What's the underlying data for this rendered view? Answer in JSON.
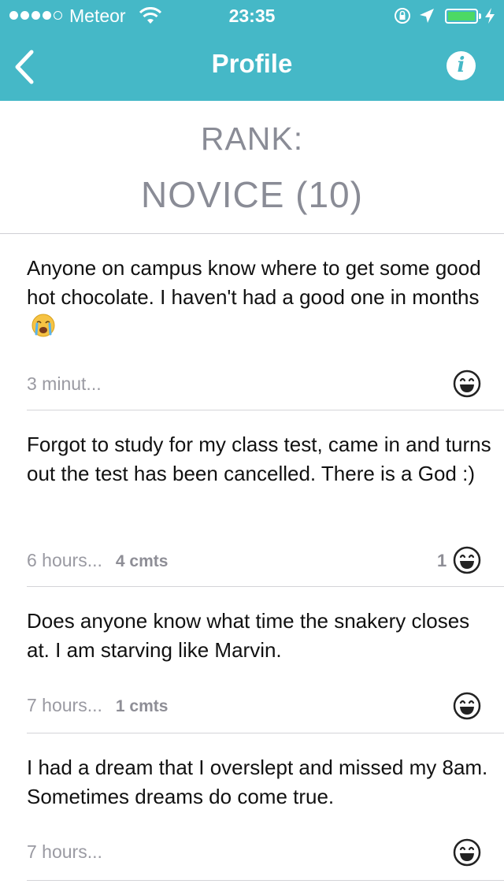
{
  "status_bar": {
    "carrier": "Meteor",
    "time": "23:35",
    "battery_color": "#4cd964"
  },
  "nav": {
    "title": "Profile",
    "accent": "#45b8c7"
  },
  "rank": {
    "label": "RANK:",
    "value": "NOVICE (10)"
  },
  "posts": [
    {
      "text": "Anyone on campus know where to get some good hot chocolate. I haven't had a good one in months",
      "emoji": "crying-face-icon",
      "time": "3 minut...",
      "comments": "",
      "votes": ""
    },
    {
      "text": "Forgot to study for my class test, came in and turns out the test has been cancelled. There is a God :)",
      "time": "6 hours...",
      "comments": "4 cmts",
      "votes": "1"
    },
    {
      "text": "Does anyone know what time the snakery closes at. I am starving like Marvin.",
      "time": "7 hours...",
      "comments": "1 cmts",
      "votes": ""
    },
    {
      "text": "I had a dream that I overslept and missed my 8am. Sometimes dreams do come true.",
      "time": "7 hours...",
      "comments": "",
      "votes": ""
    }
  ]
}
